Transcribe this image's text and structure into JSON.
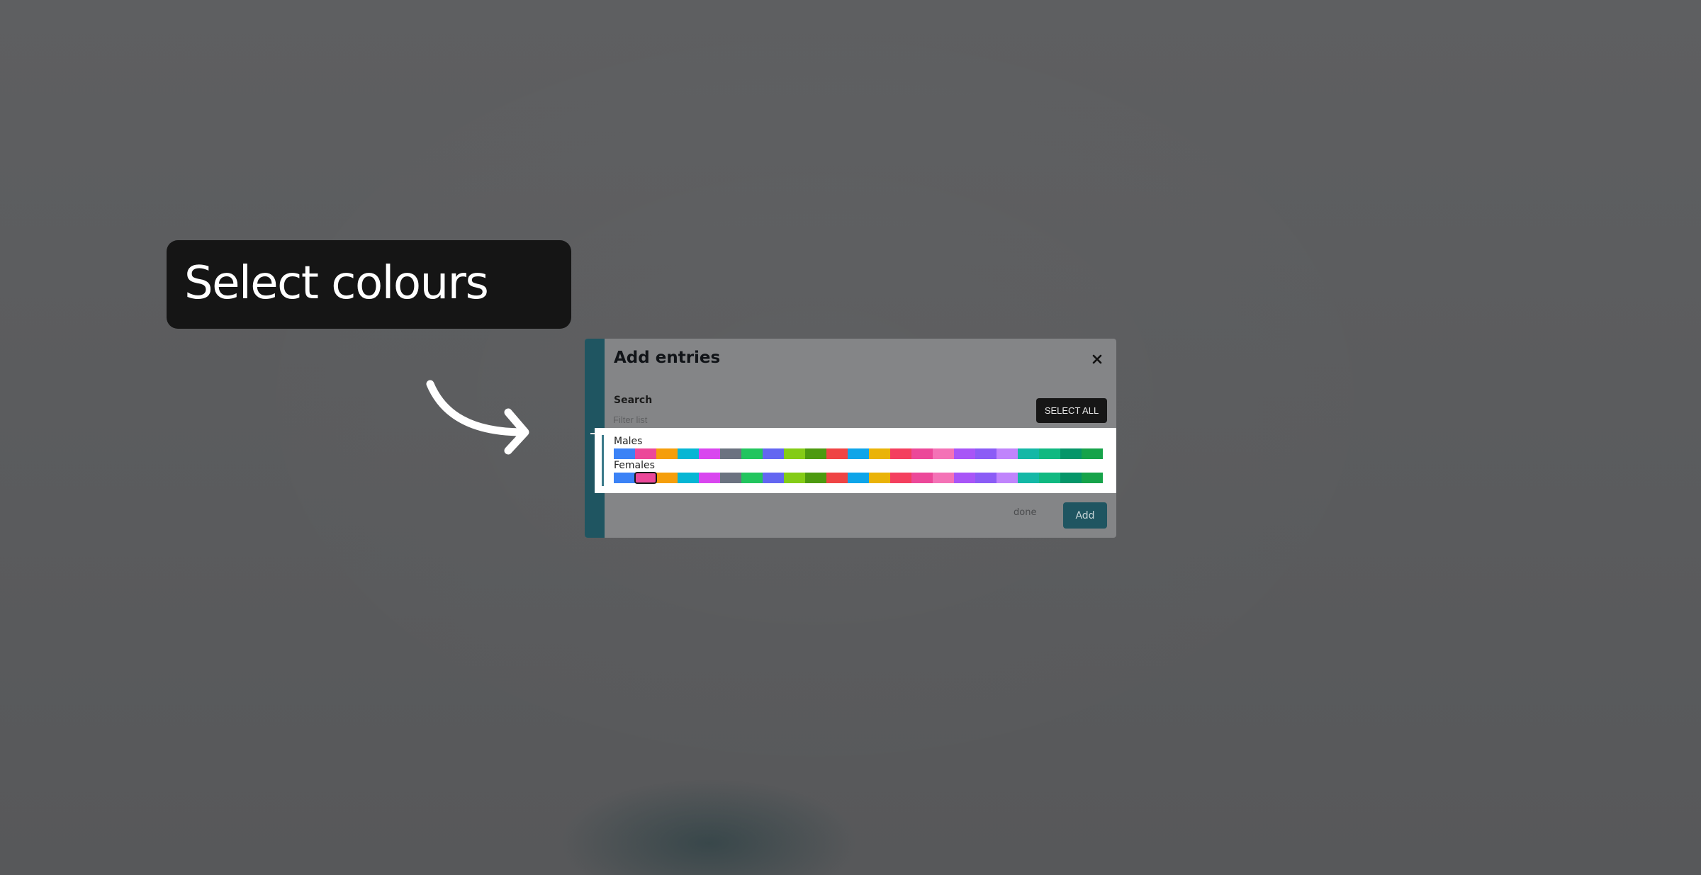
{
  "callout": {
    "text": "Select colours"
  },
  "modal": {
    "title": "Add entries",
    "search_label": "Search",
    "search_placeholder": "Filter list",
    "select_all_label": "SELECT ALL",
    "done_label": "done",
    "add_label": "Add",
    "entries": [
      {
        "label": "Males",
        "selected_index": -1
      },
      {
        "label": "Females",
        "selected_index": 1
      }
    ],
    "palette": [
      "#3b82f6",
      "#ec4899",
      "#f59e0b",
      "#06b6d4",
      "#d946ef",
      "#6b7280",
      "#22c55e",
      "#6366f1",
      "#84cc16",
      "#4d9a0f",
      "#ef4444",
      "#0ea5e9",
      "#eab308",
      "#f43f5e",
      "#ec4899",
      "#f472b6",
      "#a855f7",
      "#8b5cf6",
      "#c084fc",
      "#14b8a6",
      "#10b981",
      "#059669",
      "#16a34a"
    ]
  },
  "colors": {
    "accent": "#1f5561",
    "callout_bg": "#151515",
    "overlay": "#5b5c5e"
  }
}
